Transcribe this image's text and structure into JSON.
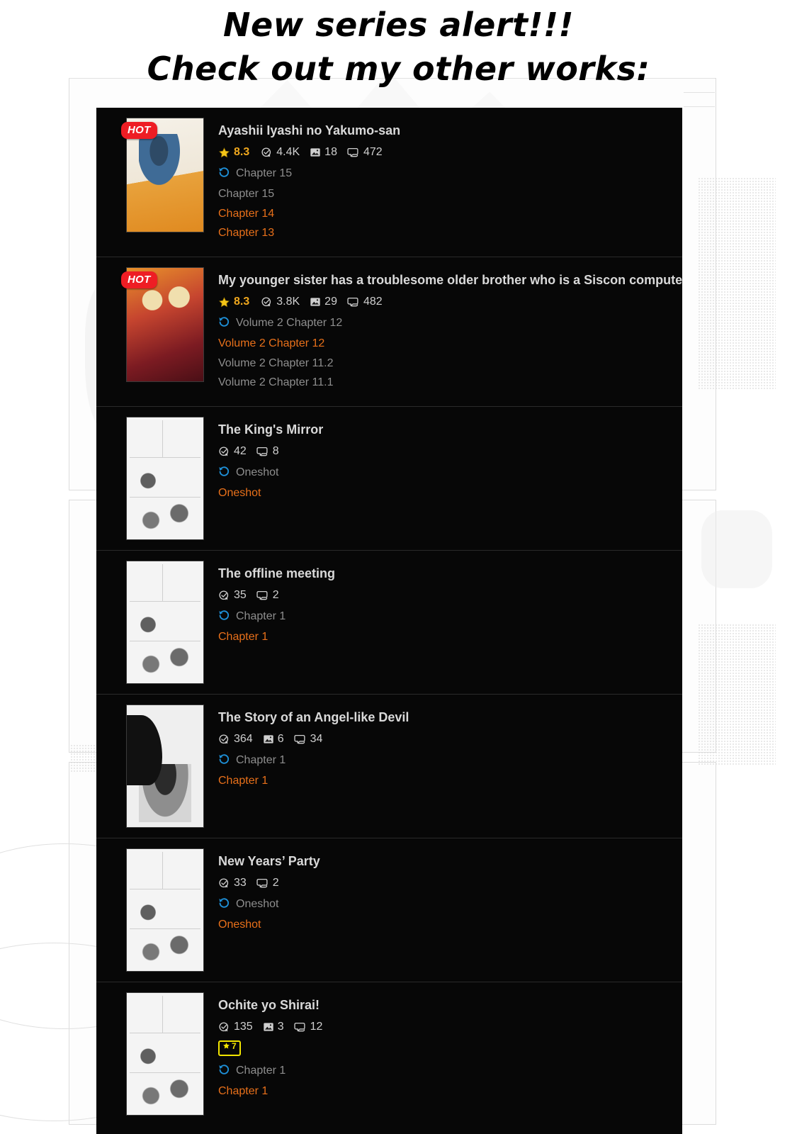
{
  "headline": {
    "line1": "New series alert!!!",
    "line2": "Check out my other works:"
  },
  "colors": {
    "panel_bg": "#070707",
    "title": "#d9d9d9",
    "stat": "#cfcfcf",
    "rating": "#f0a81e",
    "chapter_read": "#8e8e8e",
    "chapter_new": "#e8701a",
    "hot_badge": "#ee1d24",
    "rank_badge": "#f2e500",
    "history_icon": "#1e90d8"
  },
  "icons": {
    "hot": "hot-badge",
    "star": "star-icon",
    "follows": "bookmark-check-icon",
    "images": "image-icon",
    "comments": "comment-icon",
    "history": "history-clock-icon",
    "rank_star": "star-icon"
  },
  "series": [
    {
      "title": "Ayashii Iyashi no Yakumo-san",
      "hot": true,
      "hot_label": "HOT",
      "rating": "8.3",
      "follows": "4.4K",
      "images": "18",
      "comments": "472",
      "rank_badge": null,
      "latest": "Chapter 15",
      "chapters": [
        {
          "label": "Chapter 15",
          "state": "read"
        },
        {
          "label": "Chapter 14",
          "state": "new"
        },
        {
          "label": "Chapter 13",
          "state": "new"
        }
      ]
    },
    {
      "title": "My younger sister has a troublesome older brother who is a Siscon computer",
      "hot": true,
      "hot_label": "HOT",
      "rating": "8.3",
      "follows": "3.8K",
      "images": "29",
      "comments": "482",
      "rank_badge": null,
      "latest": "Volume 2 Chapter 12",
      "chapters": [
        {
          "label": "Volume 2 Chapter 12",
          "state": "new"
        },
        {
          "label": "Volume 2 Chapter 11.2",
          "state": "read"
        },
        {
          "label": "Volume 2 Chapter 11.1",
          "state": "read"
        }
      ]
    },
    {
      "title": "The King's Mirror",
      "hot": false,
      "hot_label": "",
      "rating": null,
      "follows": "42",
      "images": null,
      "comments": "8",
      "rank_badge": null,
      "latest": "Oneshot",
      "chapters": [
        {
          "label": "Oneshot",
          "state": "new"
        }
      ]
    },
    {
      "title": "The offline meeting",
      "hot": false,
      "hot_label": "",
      "rating": null,
      "follows": "35",
      "images": null,
      "comments": "2",
      "rank_badge": null,
      "latest": "Chapter 1",
      "chapters": [
        {
          "label": "Chapter 1",
          "state": "new"
        }
      ]
    },
    {
      "title": "The Story of an Angel-like Devil",
      "hot": false,
      "hot_label": "",
      "rating": null,
      "follows": "364",
      "images": "6",
      "comments": "34",
      "rank_badge": null,
      "latest": "Chapter 1",
      "chapters": [
        {
          "label": "Chapter 1",
          "state": "new"
        }
      ]
    },
    {
      "title": "New Years’ Party",
      "hot": false,
      "hot_label": "",
      "rating": null,
      "follows": "33",
      "images": null,
      "comments": "2",
      "rank_badge": null,
      "latest": "Oneshot",
      "chapters": [
        {
          "label": "Oneshot",
          "state": "new"
        }
      ]
    },
    {
      "title": "Ochite yo Shirai!",
      "hot": false,
      "hot_label": "",
      "rating": null,
      "follows": "135",
      "images": "3",
      "comments": "12",
      "rank_badge": "7",
      "latest": "Chapter 1",
      "chapters": [
        {
          "label": "Chapter 1",
          "state": "new"
        }
      ]
    }
  ]
}
